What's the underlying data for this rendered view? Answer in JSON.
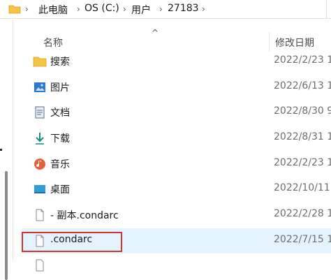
{
  "breadcrumb": {
    "segments": [
      "此电脑",
      "OS (C:)",
      "用户",
      "27183"
    ],
    "separator": "›"
  },
  "columns": {
    "name": "名称",
    "date_modified": "修改日期",
    "sort_indicator": "^"
  },
  "files": [
    {
      "name": "搜索",
      "date": "2022/2/23 1",
      "icon": "search-folder-icon"
    },
    {
      "name": "图片",
      "date": "2022/6/13 1",
      "icon": "pictures-icon"
    },
    {
      "name": "文档",
      "date": "2022/8/30 9",
      "icon": "documents-icon"
    },
    {
      "name": "下载",
      "date": "2022/8/31 1",
      "icon": "downloads-icon"
    },
    {
      "name": "音乐",
      "date": "2022/2/23 1",
      "icon": "music-icon"
    },
    {
      "name": "桌面",
      "date": "2022/10/11",
      "icon": "desktop-icon"
    },
    {
      "name": "- 副本.condarc",
      "date": "2022/2/28 1",
      "icon": "file-icon"
    },
    {
      "name": ".condarc",
      "date": "2022/7/15 1",
      "icon": "file-icon",
      "selected": true
    }
  ],
  "colors": {
    "selected_row": "#e5f3ff",
    "highlight_box": "#d0342c",
    "folder_yellow": "#f6c343"
  }
}
